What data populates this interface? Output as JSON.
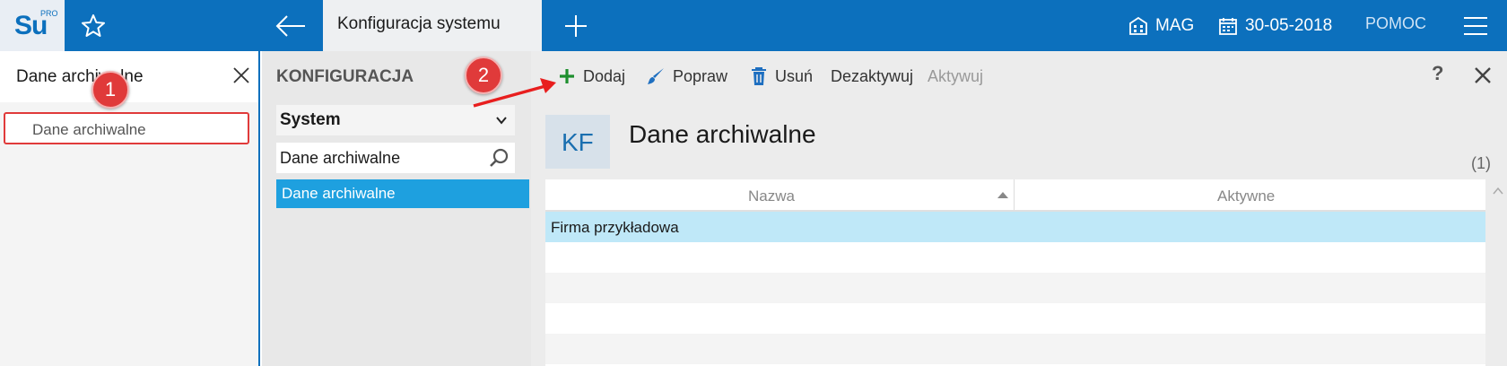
{
  "topbar": {
    "logo_main": "Su",
    "logo_super": "PRO",
    "active_tab": "Konfiguracja systemu",
    "warehouse": "MAG",
    "date": "30-05-2018",
    "help": "POMOC"
  },
  "left_panel": {
    "search_value": "Dane archiwalne",
    "result_item": "Dane archiwalne"
  },
  "middle_panel": {
    "heading": "KONFIGURACJA",
    "select_value": "System",
    "search_value": "Dane archiwalne",
    "selected_item": "Dane archiwalne"
  },
  "toolbar": {
    "add": "Dodaj",
    "edit": "Popraw",
    "delete": "Usuń",
    "deactivate": "Dezaktywuj",
    "activate": "Aktywuj",
    "help": "?"
  },
  "content": {
    "badge": "KF",
    "title": "Dane archiwalne",
    "count": "(1)",
    "columns": [
      "Nazwa",
      "Aktywne"
    ],
    "rows": [
      {
        "name": "Firma przykładowa",
        "active": ""
      }
    ]
  },
  "annotations": {
    "marker_1": "1",
    "marker_2": "2"
  },
  "colors": {
    "topbar": "#0c70bd",
    "selection": "#1ea0df",
    "row_selected": "#bfe8f8",
    "annotation": "#e03a3a",
    "add_icon": "#1e8f2e"
  }
}
